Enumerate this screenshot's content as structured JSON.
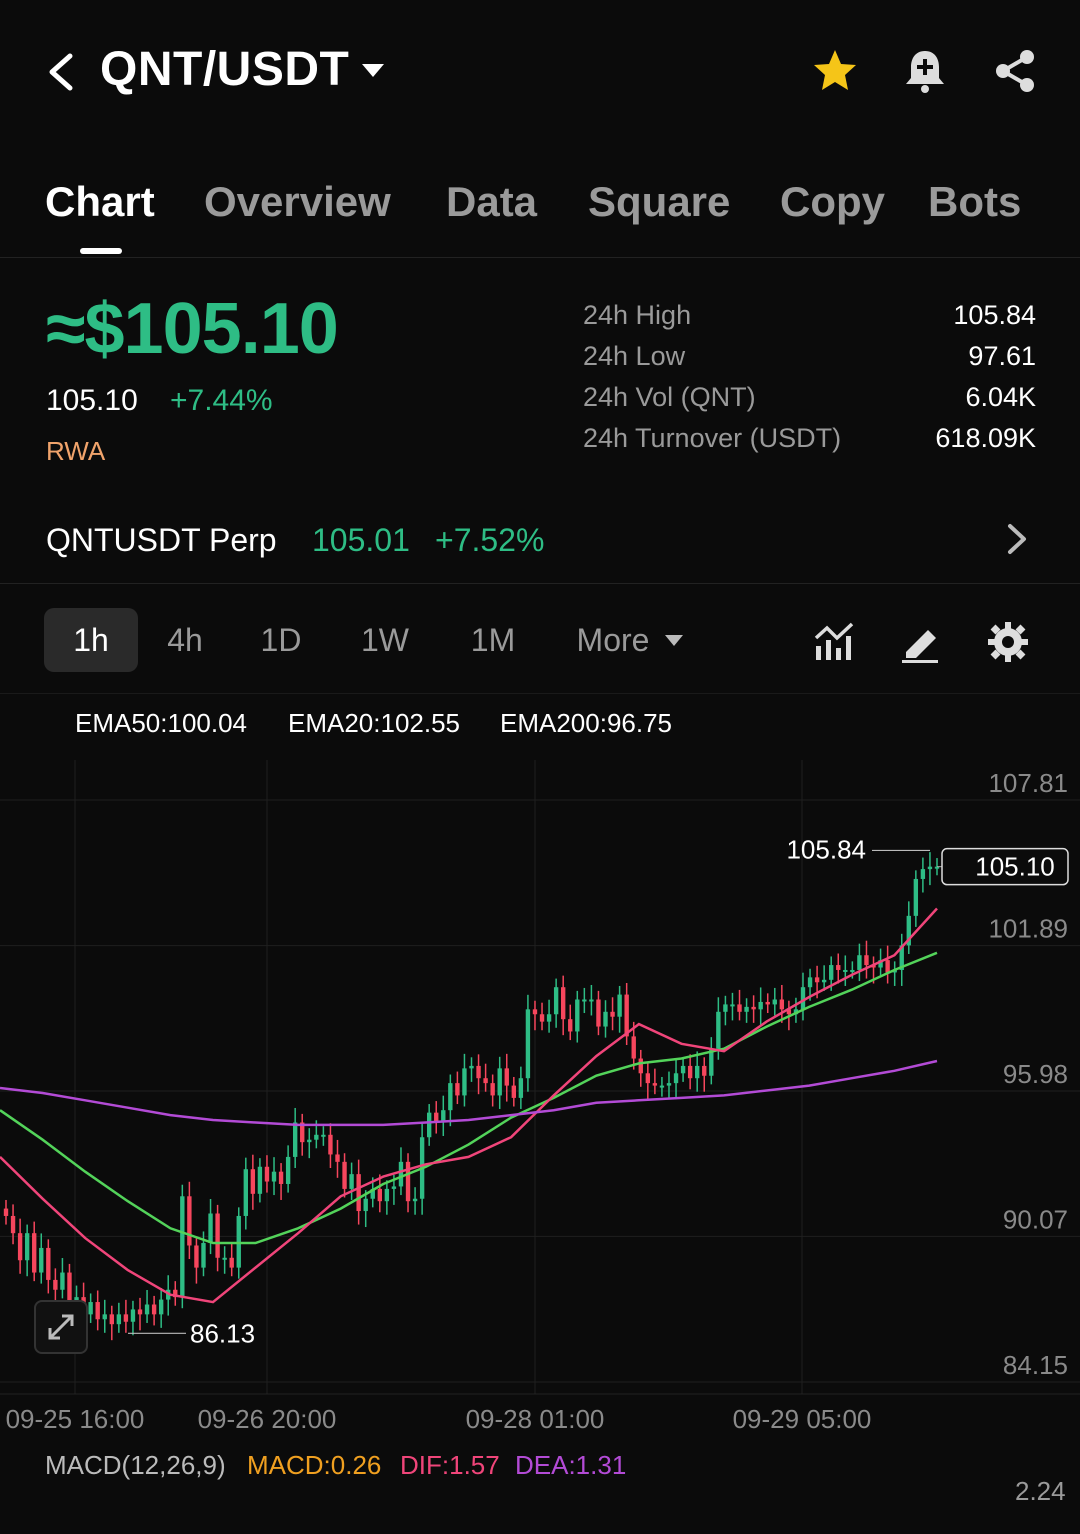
{
  "header": {
    "pair": "QNT/USDT",
    "icons": [
      "back-icon",
      "caret-down-icon",
      "star-icon",
      "bell-plus-icon",
      "share-icon"
    ],
    "star_color": "#f5c518"
  },
  "tabs": [
    {
      "label": "Chart",
      "active": true
    },
    {
      "label": "Overview"
    },
    {
      "label": "Data"
    },
    {
      "label": "Square"
    },
    {
      "label": "Copy"
    },
    {
      "label": "Bots"
    }
  ],
  "price": {
    "big": "≈$105.10",
    "last": "105.10",
    "change": "+7.44%",
    "tag": "RWA",
    "up_color": "#2ebd85",
    "down_color": "#f6465d"
  },
  "stats": [
    {
      "label": "24h High",
      "value": "105.84"
    },
    {
      "label": "24h Low",
      "value": "97.61"
    },
    {
      "label": "24h Vol (QNT)",
      "value": "6.04K"
    },
    {
      "label": "24h Turnover (USDT)",
      "value": "618.09K"
    }
  ],
  "perp": {
    "name": "QNTUSDT Perp",
    "price": "105.01",
    "change": "+7.52%"
  },
  "timeframes": [
    {
      "label": "1h",
      "active": true
    },
    {
      "label": "4h"
    },
    {
      "label": "1D"
    },
    {
      "label": "1W"
    },
    {
      "label": "1M"
    },
    {
      "label": "More"
    }
  ],
  "toolbar_icons": [
    "indicators-icon",
    "draw-icon",
    "settings-icon"
  ],
  "ema": [
    {
      "label": "EMA50:100.04",
      "color": "#53d35a"
    },
    {
      "label": "EMA20:102.55",
      "color": "#f0457a"
    },
    {
      "label": "EMA200:96.75",
      "color": "#b34bd6"
    }
  ],
  "chart_data": {
    "type": "candlestick",
    "y_ticks": [
      "107.81",
      "101.89",
      "95.98",
      "90.07",
      "84.15"
    ],
    "ylim": [
      84.15,
      107.81
    ],
    "x_ticks": [
      "09-25 16:00",
      "09-26 20:00",
      "09-28 01:00",
      "09-29 05:00"
    ],
    "high_label": "105.84",
    "low_label": "86.13",
    "last_label": "105.10",
    "close": [
      90.9,
      90.2,
      89.1,
      90.2,
      88.6,
      89.6,
      88.3,
      87.9,
      88.6,
      87.2,
      87.6,
      86.9,
      87.4,
      86.7,
      86.9,
      86.5,
      86.9,
      86.6,
      87.1,
      86.9,
      87.3,
      86.9,
      87.5,
      87.9,
      87.6,
      91.7,
      89.7,
      88.8,
      89.8,
      91.0,
      89.2,
      89.2,
      88.8,
      90.9,
      92.8,
      91.8,
      92.9,
      92.3,
      92.7,
      92.2,
      93.3,
      94.7,
      93.9,
      94.0,
      94.2,
      94.2,
      93.4,
      93.1,
      92.0,
      92.6,
      91.1,
      91.6,
      92.0,
      91.5,
      92.0,
      92.1,
      93.1,
      91.5,
      91.6,
      94.1,
      95.1,
      94.7,
      95.2,
      96.3,
      95.8,
      96.9,
      97.0,
      96.5,
      96.3,
      95.8,
      96.9,
      96.2,
      95.7,
      96.5,
      99.3,
      99.1,
      98.8,
      99.1,
      100.2,
      98.9,
      98.4,
      99.7,
      99.7,
      99.7,
      98.6,
      99.2,
      99.0,
      99.9,
      98.2,
      97.3,
      96.7,
      96.3,
      96.2,
      96.2,
      96.3,
      96.7,
      97.0,
      96.5,
      97.0,
      96.6,
      97.7,
      99.2,
      99.5,
      99.5,
      99.2,
      99.4,
      99.3,
      99.6,
      99.5,
      99.7,
      99.3,
      99.1,
      99.3,
      100.2,
      100.6,
      100.4,
      100.5,
      101.1,
      100.9,
      100.9,
      100.9,
      101.5,
      101.1,
      101.0,
      101.3,
      100.8,
      100.9,
      101.9,
      103.1,
      104.6,
      105.0,
      105.1,
      105.1
    ],
    "series": [
      {
        "name": "EMA50",
        "values": [
          95.2,
          94.0,
          92.7,
          91.5,
          90.4,
          89.8,
          89.8,
          90.4,
          91.2,
          92.2,
          92.9,
          93.8,
          94.9,
          95.7,
          96.6,
          97.1,
          97.3,
          97.7,
          98.6,
          99.4,
          100.1,
          100.9,
          101.6
        ]
      },
      {
        "name": "EMA20",
        "values": [
          93.3,
          91.6,
          90.0,
          88.7,
          87.7,
          87.4,
          88.8,
          90.2,
          91.7,
          92.5,
          93.0,
          93.3,
          94.1,
          95.8,
          97.4,
          98.7,
          97.9,
          97.6,
          98.8,
          99.8,
          100.7,
          101.5,
          103.4
        ]
      },
      {
        "name": "EMA200",
        "values": [
          96.1,
          95.9,
          95.6,
          95.3,
          95.0,
          94.8,
          94.7,
          94.6,
          94.6,
          94.6,
          94.7,
          94.8,
          95.0,
          95.2,
          95.5,
          95.6,
          95.7,
          95.8,
          96.0,
          96.2,
          96.5,
          96.8,
          97.2
        ]
      }
    ]
  },
  "macd": {
    "title": "MACD(12,26,9)",
    "macd": "MACD:0.26",
    "dif": "DIF:1.57",
    "dea": "DEA:1.31",
    "top_tick": "2.24"
  }
}
